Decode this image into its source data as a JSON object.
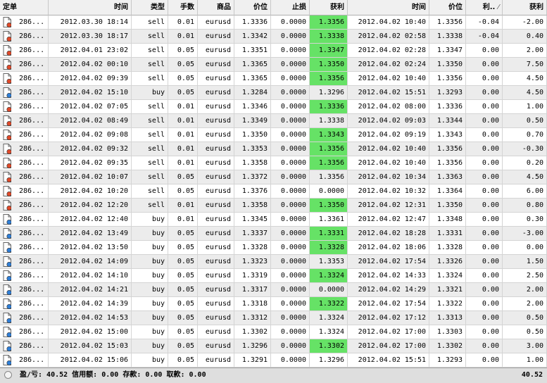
{
  "headers": {
    "ticket": "定单",
    "open_time": "时间",
    "type": "类型",
    "lots": "手数",
    "symbol": "商品",
    "open_price": "价位",
    "sl": "止损",
    "tp": "获利",
    "close_time": "时间",
    "close_price": "价位",
    "swap": "利..",
    "profit": "获利"
  },
  "highlight_color": "#66e266",
  "icons": {
    "sell": "sell-order-doc-icon",
    "buy": "buy-order-doc-icon",
    "status": "status-circle-icon",
    "sort": "sort-indicator-icon"
  },
  "rows": [
    {
      "ticket": "286...",
      "open_time": "2012.03.30 18:14",
      "type": "sell",
      "lots": "0.01",
      "symbol": "eurusd",
      "open_price": "1.3336",
      "sl": "0.0000",
      "tp": "1.3356",
      "tp_hl": true,
      "close_time": "2012.04.02 10:40",
      "close_price": "1.3356",
      "swap": "-0.04",
      "profit": "-2.00"
    },
    {
      "ticket": "286...",
      "open_time": "2012.03.30 18:17",
      "type": "sell",
      "lots": "0.01",
      "symbol": "eurusd",
      "open_price": "1.3342",
      "sl": "0.0000",
      "tp": "1.3338",
      "tp_hl": true,
      "close_time": "2012.04.02 02:58",
      "close_price": "1.3338",
      "swap": "-0.04",
      "profit": "0.40"
    },
    {
      "ticket": "286...",
      "open_time": "2012.04.01 23:02",
      "type": "sell",
      "lots": "0.05",
      "symbol": "eurusd",
      "open_price": "1.3351",
      "sl": "0.0000",
      "tp": "1.3347",
      "tp_hl": true,
      "close_time": "2012.04.02 02:28",
      "close_price": "1.3347",
      "swap": "0.00",
      "profit": "2.00"
    },
    {
      "ticket": "286...",
      "open_time": "2012.04.02 00:10",
      "type": "sell",
      "lots": "0.05",
      "symbol": "eurusd",
      "open_price": "1.3365",
      "sl": "0.0000",
      "tp": "1.3350",
      "tp_hl": true,
      "close_time": "2012.04.02 02:24",
      "close_price": "1.3350",
      "swap": "0.00",
      "profit": "7.50"
    },
    {
      "ticket": "286...",
      "open_time": "2012.04.02 09:39",
      "type": "sell",
      "lots": "0.05",
      "symbol": "eurusd",
      "open_price": "1.3365",
      "sl": "0.0000",
      "tp": "1.3356",
      "tp_hl": true,
      "close_time": "2012.04.02 10:40",
      "close_price": "1.3356",
      "swap": "0.00",
      "profit": "4.50"
    },
    {
      "ticket": "286...",
      "open_time": "2012.04.02 15:10",
      "type": "buy",
      "lots": "0.05",
      "symbol": "eurusd",
      "open_price": "1.3284",
      "sl": "0.0000",
      "tp": "1.3296",
      "tp_hl": false,
      "close_time": "2012.04.02 15:51",
      "close_price": "1.3293",
      "swap": "0.00",
      "profit": "4.50"
    },
    {
      "ticket": "286...",
      "open_time": "2012.04.02 07:05",
      "type": "sell",
      "lots": "0.01",
      "symbol": "eurusd",
      "open_price": "1.3346",
      "sl": "0.0000",
      "tp": "1.3336",
      "tp_hl": true,
      "close_time": "2012.04.02 08:00",
      "close_price": "1.3336",
      "swap": "0.00",
      "profit": "1.00"
    },
    {
      "ticket": "286...",
      "open_time": "2012.04.02 08:49",
      "type": "sell",
      "lots": "0.01",
      "symbol": "eurusd",
      "open_price": "1.3349",
      "sl": "0.0000",
      "tp": "1.3338",
      "tp_hl": false,
      "close_time": "2012.04.02 09:03",
      "close_price": "1.3344",
      "swap": "0.00",
      "profit": "0.50"
    },
    {
      "ticket": "286...",
      "open_time": "2012.04.02 09:08",
      "type": "sell",
      "lots": "0.01",
      "symbol": "eurusd",
      "open_price": "1.3350",
      "sl": "0.0000",
      "tp": "1.3343",
      "tp_hl": true,
      "close_time": "2012.04.02 09:19",
      "close_price": "1.3343",
      "swap": "0.00",
      "profit": "0.70"
    },
    {
      "ticket": "286...",
      "open_time": "2012.04.02 09:32",
      "type": "sell",
      "lots": "0.01",
      "symbol": "eurusd",
      "open_price": "1.3353",
      "sl": "0.0000",
      "tp": "1.3356",
      "tp_hl": true,
      "close_time": "2012.04.02 10:40",
      "close_price": "1.3356",
      "swap": "0.00",
      "profit": "-0.30"
    },
    {
      "ticket": "286...",
      "open_time": "2012.04.02 09:35",
      "type": "sell",
      "lots": "0.01",
      "symbol": "eurusd",
      "open_price": "1.3358",
      "sl": "0.0000",
      "tp": "1.3356",
      "tp_hl": true,
      "close_time": "2012.04.02 10:40",
      "close_price": "1.3356",
      "swap": "0.00",
      "profit": "0.20"
    },
    {
      "ticket": "286...",
      "open_time": "2012.04.02 10:07",
      "type": "sell",
      "lots": "0.05",
      "symbol": "eurusd",
      "open_price": "1.3372",
      "sl": "0.0000",
      "tp": "1.3356",
      "tp_hl": false,
      "close_time": "2012.04.02 10:34",
      "close_price": "1.3363",
      "swap": "0.00",
      "profit": "4.50"
    },
    {
      "ticket": "286...",
      "open_time": "2012.04.02 10:20",
      "type": "sell",
      "lots": "0.05",
      "symbol": "eurusd",
      "open_price": "1.3376",
      "sl": "0.0000",
      "tp": "0.0000",
      "tp_hl": false,
      "close_time": "2012.04.02 10:32",
      "close_price": "1.3364",
      "swap": "0.00",
      "profit": "6.00"
    },
    {
      "ticket": "286...",
      "open_time": "2012.04.02 12:20",
      "type": "sell",
      "lots": "0.01",
      "symbol": "eurusd",
      "open_price": "1.3358",
      "sl": "0.0000",
      "tp": "1.3350",
      "tp_hl": true,
      "close_time": "2012.04.02 12:31",
      "close_price": "1.3350",
      "swap": "0.00",
      "profit": "0.80"
    },
    {
      "ticket": "286...",
      "open_time": "2012.04.02 12:40",
      "type": "buy",
      "lots": "0.01",
      "symbol": "eurusd",
      "open_price": "1.3345",
      "sl": "0.0000",
      "tp": "1.3361",
      "tp_hl": false,
      "close_time": "2012.04.02 12:47",
      "close_price": "1.3348",
      "swap": "0.00",
      "profit": "0.30"
    },
    {
      "ticket": "286...",
      "open_time": "2012.04.02 13:49",
      "type": "buy",
      "lots": "0.05",
      "symbol": "eurusd",
      "open_price": "1.3337",
      "sl": "0.0000",
      "tp": "1.3331",
      "tp_hl": true,
      "close_time": "2012.04.02 18:28",
      "close_price": "1.3331",
      "swap": "0.00",
      "profit": "-3.00"
    },
    {
      "ticket": "286...",
      "open_time": "2012.04.02 13:50",
      "type": "buy",
      "lots": "0.05",
      "symbol": "eurusd",
      "open_price": "1.3328",
      "sl": "0.0000",
      "tp": "1.3328",
      "tp_hl": true,
      "close_time": "2012.04.02 18:06",
      "close_price": "1.3328",
      "swap": "0.00",
      "profit": "0.00"
    },
    {
      "ticket": "286...",
      "open_time": "2012.04.02 14:09",
      "type": "buy",
      "lots": "0.05",
      "symbol": "eurusd",
      "open_price": "1.3323",
      "sl": "0.0000",
      "tp": "1.3353",
      "tp_hl": false,
      "close_time": "2012.04.02 17:54",
      "close_price": "1.3326",
      "swap": "0.00",
      "profit": "1.50"
    },
    {
      "ticket": "286...",
      "open_time": "2012.04.02 14:10",
      "type": "buy",
      "lots": "0.05",
      "symbol": "eurusd",
      "open_price": "1.3319",
      "sl": "0.0000",
      "tp": "1.3324",
      "tp_hl": true,
      "close_time": "2012.04.02 14:33",
      "close_price": "1.3324",
      "swap": "0.00",
      "profit": "2.50"
    },
    {
      "ticket": "286...",
      "open_time": "2012.04.02 14:21",
      "type": "buy",
      "lots": "0.05",
      "symbol": "eurusd",
      "open_price": "1.3317",
      "sl": "0.0000",
      "tp": "0.0000",
      "tp_hl": false,
      "close_time": "2012.04.02 14:29",
      "close_price": "1.3321",
      "swap": "0.00",
      "profit": "2.00"
    },
    {
      "ticket": "286...",
      "open_time": "2012.04.02 14:39",
      "type": "buy",
      "lots": "0.05",
      "symbol": "eurusd",
      "open_price": "1.3318",
      "sl": "0.0000",
      "tp": "1.3322",
      "tp_hl": true,
      "close_time": "2012.04.02 17:54",
      "close_price": "1.3322",
      "swap": "0.00",
      "profit": "2.00"
    },
    {
      "ticket": "286...",
      "open_time": "2012.04.02 14:53",
      "type": "buy",
      "lots": "0.05",
      "symbol": "eurusd",
      "open_price": "1.3312",
      "sl": "0.0000",
      "tp": "1.3324",
      "tp_hl": false,
      "close_time": "2012.04.02 17:12",
      "close_price": "1.3313",
      "swap": "0.00",
      "profit": "0.50"
    },
    {
      "ticket": "286...",
      "open_time": "2012.04.02 15:00",
      "type": "buy",
      "lots": "0.05",
      "symbol": "eurusd",
      "open_price": "1.3302",
      "sl": "0.0000",
      "tp": "1.3324",
      "tp_hl": false,
      "close_time": "2012.04.02 17:00",
      "close_price": "1.3303",
      "swap": "0.00",
      "profit": "0.50"
    },
    {
      "ticket": "286...",
      "open_time": "2012.04.02 15:03",
      "type": "buy",
      "lots": "0.05",
      "symbol": "eurusd",
      "open_price": "1.3296",
      "sl": "0.0000",
      "tp": "1.3302",
      "tp_hl": true,
      "close_time": "2012.04.02 17:00",
      "close_price": "1.3302",
      "swap": "0.00",
      "profit": "3.00"
    },
    {
      "ticket": "286...",
      "open_time": "2012.04.02 15:06",
      "type": "buy",
      "lots": "0.05",
      "symbol": "eurusd",
      "open_price": "1.3291",
      "sl": "0.0000",
      "tp": "1.3296",
      "tp_hl": false,
      "close_time": "2012.04.02 15:51",
      "close_price": "1.3293",
      "swap": "0.00",
      "profit": "1.00"
    }
  ],
  "status": {
    "summary": "盈/亏: 40.52  信用额: 0.00  存款: 0.00  取款: 0.00",
    "total": "40.52"
  }
}
